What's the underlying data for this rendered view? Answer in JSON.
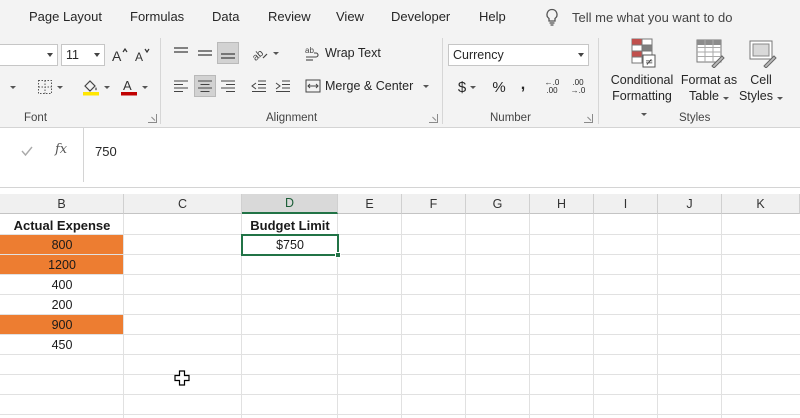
{
  "menu": {
    "tabs": [
      "Page Layout",
      "Formulas",
      "Data",
      "Review",
      "View",
      "Developer",
      "Help"
    ],
    "tell_me": "Tell me what you want to do"
  },
  "ribbon": {
    "font": {
      "size": "11",
      "group_label": "Font",
      "font_color": "#c00000",
      "fill_color": "#ffe600"
    },
    "alignment": {
      "wrap_text": "Wrap Text",
      "merge_center": "Merge & Center",
      "group_label": "Alignment"
    },
    "number": {
      "format": "Currency",
      "currency_symbol": "$",
      "percent_symbol": "%",
      "comma_symbol": ",",
      "increase_decimal": "←.0 .00",
      "decrease_decimal": ".00 →.0",
      "group_label": "Number"
    },
    "styles": {
      "conditional_formatting": [
        "Conditional",
        "Formatting"
      ],
      "format_as_table": [
        "Format as",
        "Table"
      ],
      "cell_styles": [
        "Cell",
        "Styles"
      ],
      "group_label": "Styles"
    }
  },
  "formula_bar": {
    "value": "750",
    "fx": "fx"
  },
  "columns": [
    "B",
    "C",
    "D",
    "E",
    "F",
    "G",
    "H",
    "I",
    "J",
    "K"
  ],
  "active_column": "D",
  "sheet": {
    "actual_expense_header": "Actual Expense",
    "actual_expense": [
      "800",
      "1200",
      "400",
      "200",
      "900",
      "450"
    ],
    "highlighted_rows": [
      0,
      1,
      4
    ],
    "budget_header": "Budget Limit",
    "budget_value": "$750",
    "highlight_color": "#ed7d31",
    "accent_color": "#217346"
  }
}
